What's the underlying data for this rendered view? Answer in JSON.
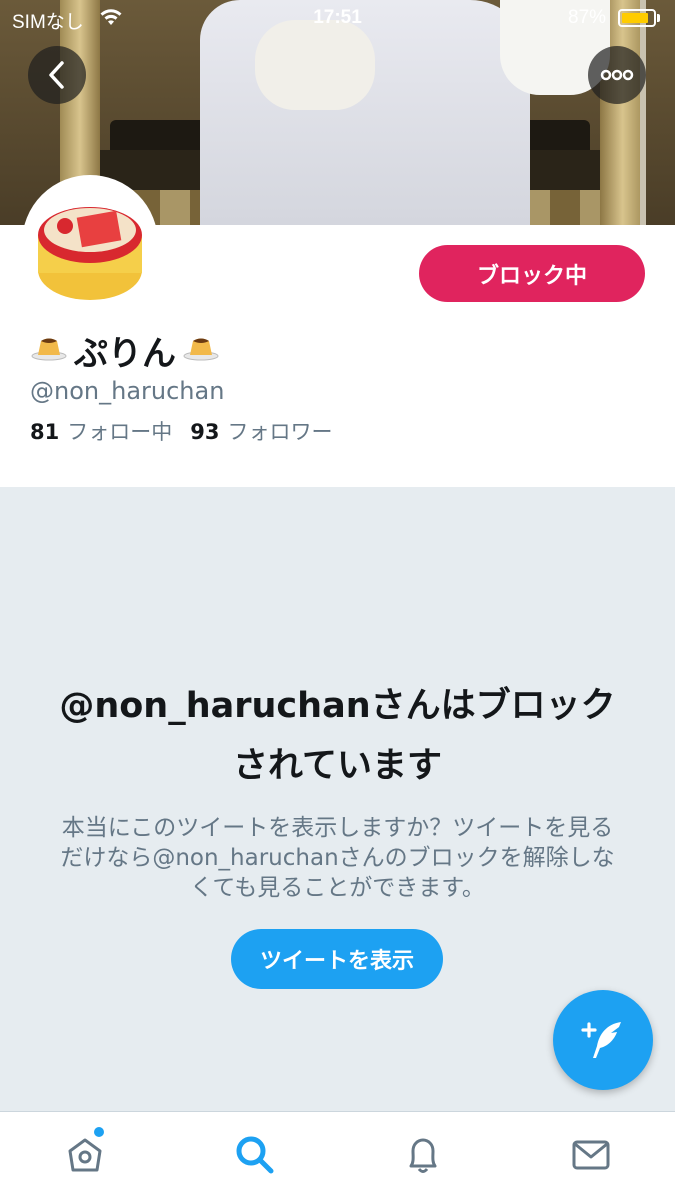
{
  "status_bar": {
    "carrier": "SIMなし",
    "time": "17:51",
    "battery_percent": "87%",
    "battery_level": 0.87
  },
  "header": {
    "back_icon": "chevron-left-icon",
    "more_icon": "more-dots-icon"
  },
  "profile": {
    "name_text": "ぷりん",
    "name_emoji": "pudding-icon",
    "handle": "@non_haruchan",
    "following_count": "81",
    "following_label": "フォロー中",
    "followers_count": "93",
    "followers_label": "フォロワー",
    "block_button_label": "ブロック中",
    "avatar_text": "プッチンプリン"
  },
  "blocked": {
    "title": "@non_haruchanさんはブロックされています",
    "description": "本当にこのツイートを表示しますか？ツイートを見るだけなら@non_haruchanさんのブロックを解除しなくても見ることができます。",
    "show_button_label": "ツイートを表示"
  },
  "tabbar": {
    "items": [
      "home-icon",
      "search-icon",
      "bell-icon",
      "mail-icon"
    ],
    "active": "search-icon"
  },
  "colors": {
    "accent": "#1da1f2",
    "block": "#e0245e",
    "background": "#e6ecf0"
  }
}
